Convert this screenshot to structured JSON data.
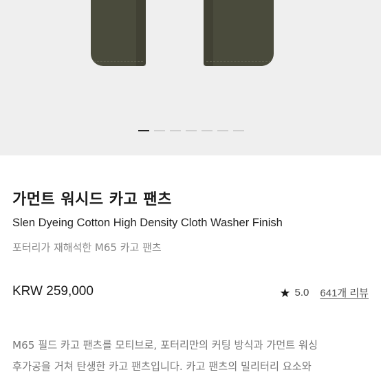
{
  "gallery": {
    "slide_count": 7,
    "active_index": 0
  },
  "product": {
    "name": "가먼트 워시드 카고 팬츠",
    "english_name": "Slen Dyeing Cotton High Density Cloth Washer Finish",
    "tagline": "포터리가 재해석한 M65 카고 팬츠",
    "price": "KRW 259,000",
    "rating_icon": "star-icon",
    "rating": "5.0",
    "review_link": "641개 리뷰"
  },
  "description": {
    "lines": [
      "M65 필드 카고 팬츠를 모티브로, 포터리만의 커팅 방식과 가먼트 워싱",
      "후가공을 거쳐 탄생한 카고 팬츠입니다. 카고 팬츠의 밀리터리 요소와"
    ]
  },
  "colors": {
    "product_fabric": "#4a4b3c",
    "gallery_bg": "#efefef",
    "indicator_active": "#222222",
    "indicator_inactive": "#cfcfcf"
  }
}
